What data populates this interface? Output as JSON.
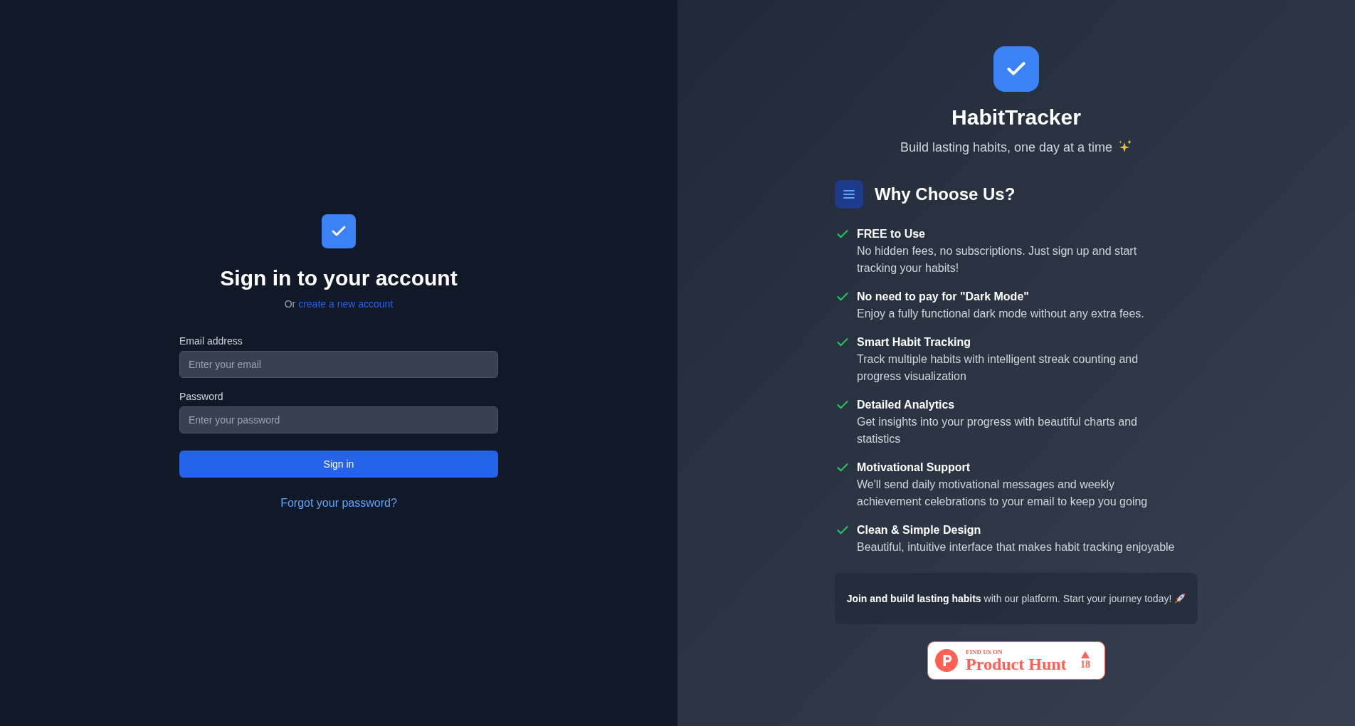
{
  "sign_in_panel": {
    "title": "Sign in to your account",
    "prompt": "Or",
    "create_account_link": "create a new account",
    "fields": [
      {
        "label": "Email address",
        "placeholder": "Enter your email"
      },
      {
        "label": "Password",
        "placeholder": "Enter your password"
      }
    ],
    "submit_button": "Sign in",
    "forgot_password_link": "Forgot your password?"
  },
  "promo_panel": {
    "app_name": "HabitTracker",
    "tagline": "Build lasting habits, one day at a time",
    "section_title": "Why Choose Us?",
    "features": [
      {
        "title": "FREE to Use",
        "description": "No hidden fees, no subscriptions. Just sign up and start tracking your habits!"
      },
      {
        "title": "No need to pay for \"Dark Mode\"",
        "description": "Enjoy a fully functional dark mode without any extra fees."
      },
      {
        "title": "Smart Habit Tracking",
        "description": "Track multiple habits with intelligent streak counting and progress visualization"
      },
      {
        "title": "Detailed Analytics",
        "description": "Get insights into your progress with beautiful charts and statistics"
      },
      {
        "title": "Motivational Support",
        "description": "We'll send daily motivational messages and weekly achievement celebrations to your email to keep you going"
      },
      {
        "title": "Clean & Simple Design",
        "description": "Beautiful, intuitive interface that makes habit tracking enjoyable"
      }
    ],
    "callout": "**Join and build lasting habits** with our platform. Start your journey today!",
    "badge": {
      "caption": "FIND US ON",
      "name": "Product Hunt",
      "votes": "18"
    }
  }
}
